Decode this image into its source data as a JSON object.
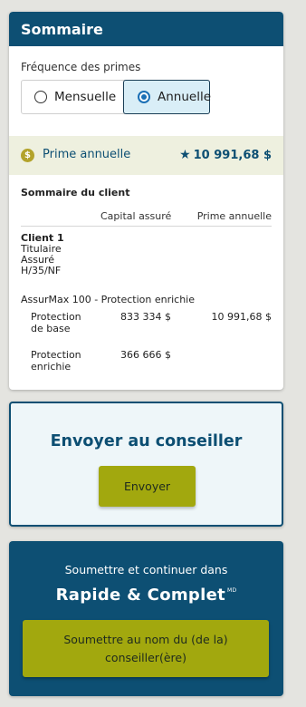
{
  "summary": {
    "title": "Sommaire",
    "frequency_label": "Fréquence des primes",
    "options": {
      "monthly": "Mensuelle",
      "annual": "Annuelle"
    },
    "selected_option": "annual",
    "premium_label": "Prime annuelle",
    "premium_star": "★",
    "premium_value": "10 991,68 $",
    "client_section_title": "Sommaire du client",
    "columns": {
      "capital": "Capital assuré",
      "premium": "Prime annuelle"
    },
    "client": {
      "name": "Client 1",
      "lines": [
        "Titulaire",
        "Assuré",
        "H/35/NF"
      ]
    },
    "product": "AssurMax 100 - Protection enrichie",
    "coverages": [
      {
        "name": "Protection de base",
        "capital": "833 334 $",
        "premium": "10 991,68 $"
      },
      {
        "name": "Protection enrichie",
        "capital": "366 666 $",
        "premium": ""
      }
    ]
  },
  "send": {
    "title": "Envoyer au conseiller",
    "button": "Envoyer"
  },
  "submit": {
    "intro": "Soumettre et continuer dans",
    "brand": "Rapide & Complet",
    "brand_mark": "MD",
    "button": "Soumettre au nom du (de la) conseiller(ère)"
  },
  "colors": {
    "primary": "#0d4f73",
    "accent": "#a2a80e",
    "premium_bg": "#eef0df",
    "send_bg": "#eef6f9"
  }
}
